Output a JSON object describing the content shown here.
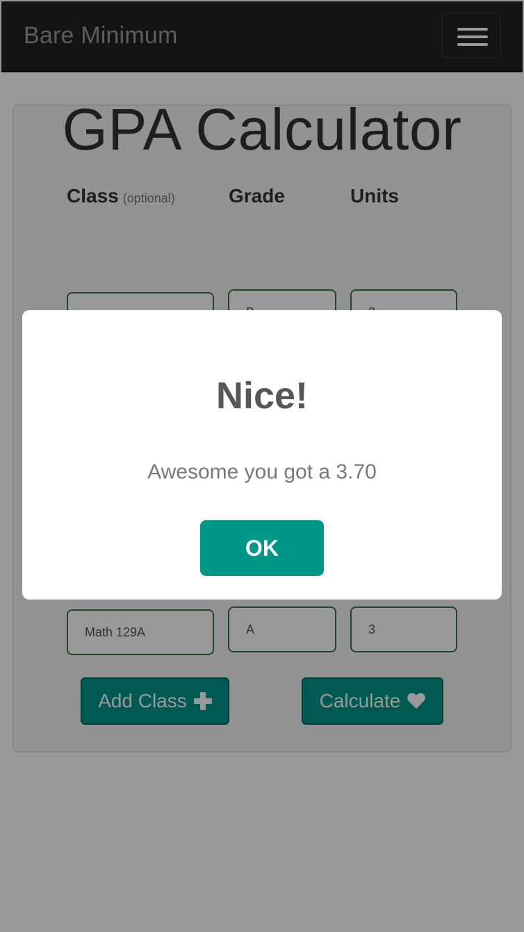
{
  "navbar": {
    "brand": "Bare Minimum",
    "menu_icon": "hamburger-menu-icon"
  },
  "main": {
    "title": "GPA Calculator",
    "columns": {
      "class_label": "Class",
      "class_optional": "(optional)",
      "grade_label": "Grade",
      "units_label": "Units"
    },
    "rows": [
      {
        "class": "",
        "grade": "B",
        "units": "3"
      },
      {
        "class": "Math 129A",
        "grade": "A",
        "units": "3"
      }
    ],
    "add_class_label": "Add Class",
    "add_class_icon": "plus-icon",
    "calculate_label": "Calculate",
    "calculate_icon": "heart-icon"
  },
  "modal": {
    "title": "Nice!",
    "message": "Awesome you got a 3.70",
    "ok_label": "OK"
  },
  "colors": {
    "accent": "#009688",
    "navbar": "#222222",
    "input_border": "#3c763d"
  }
}
